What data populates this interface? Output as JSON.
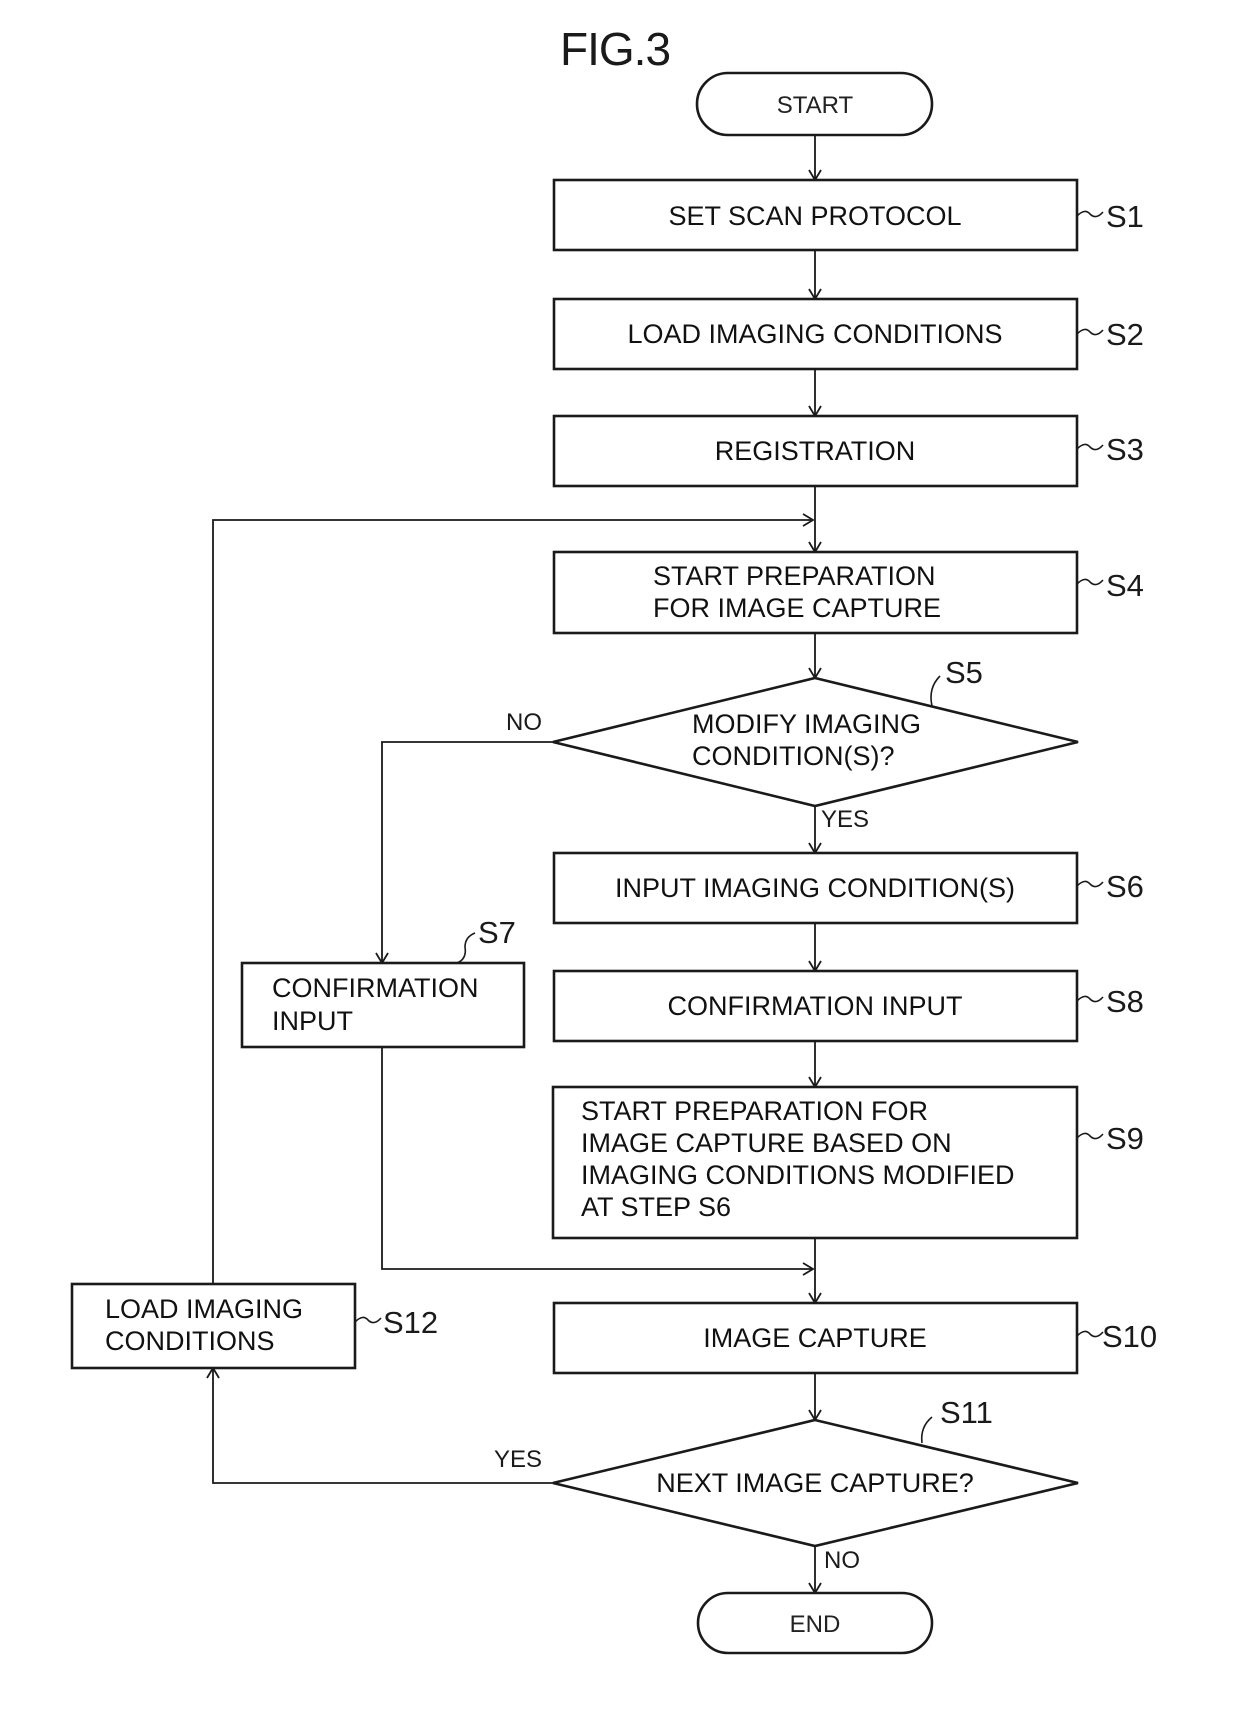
{
  "figure": {
    "title": "FIG.3"
  },
  "terminals": {
    "start": "START",
    "end": "END"
  },
  "steps": {
    "s1": {
      "id": "S1",
      "lines": [
        "SET SCAN PROTOCOL"
      ]
    },
    "s2": {
      "id": "S2",
      "lines": [
        "LOAD IMAGING CONDITIONS"
      ]
    },
    "s3": {
      "id": "S3",
      "lines": [
        "REGISTRATION"
      ]
    },
    "s4": {
      "id": "S4",
      "lines": [
        "START PREPARATION",
        "FOR IMAGE CAPTURE"
      ]
    },
    "s5": {
      "id": "S5",
      "type": "decision",
      "lines": [
        "MODIFY IMAGING",
        "CONDITION(S)?"
      ],
      "yes": "YES",
      "no": "NO"
    },
    "s6": {
      "id": "S6",
      "lines": [
        "INPUT IMAGING CONDITION(S)"
      ]
    },
    "s7": {
      "id": "S7",
      "lines": [
        "CONFIRMATION",
        "INPUT"
      ]
    },
    "s8": {
      "id": "S8",
      "lines": [
        "CONFIRMATION INPUT"
      ]
    },
    "s9": {
      "id": "S9",
      "lines": [
        "START PREPARATION FOR",
        "IMAGE CAPTURE BASED ON",
        "IMAGING CONDITIONS MODIFIED",
        "AT STEP S6"
      ]
    },
    "s10": {
      "id": "S10",
      "lines": [
        "IMAGE CAPTURE"
      ]
    },
    "s11": {
      "id": "S11",
      "type": "decision",
      "lines": [
        "NEXT IMAGE CAPTURE?"
      ],
      "yes": "YES",
      "no": "NO"
    },
    "s12": {
      "id": "S12",
      "lines": [
        "LOAD IMAGING",
        "CONDITIONS"
      ]
    }
  },
  "connections": [
    {
      "from": "START",
      "to": "S1"
    },
    {
      "from": "S1",
      "to": "S2"
    },
    {
      "from": "S2",
      "to": "S3"
    },
    {
      "from": "S3",
      "to": "S4"
    },
    {
      "from": "S4",
      "to": "S5"
    },
    {
      "from": "S5",
      "to": "S6",
      "label": "YES"
    },
    {
      "from": "S5",
      "to": "S7",
      "label": "NO"
    },
    {
      "from": "S6",
      "to": "S8"
    },
    {
      "from": "S8",
      "to": "S9"
    },
    {
      "from": "S9",
      "to": "S10"
    },
    {
      "from": "S7",
      "to": "S10"
    },
    {
      "from": "S10",
      "to": "S11"
    },
    {
      "from": "S11",
      "to": "S12",
      "label": "YES"
    },
    {
      "from": "S11",
      "to": "END",
      "label": "NO"
    },
    {
      "from": "S12",
      "to": "S4"
    }
  ],
  "colors": {
    "ink": "#1a1a1a",
    "background": "#ffffff"
  }
}
